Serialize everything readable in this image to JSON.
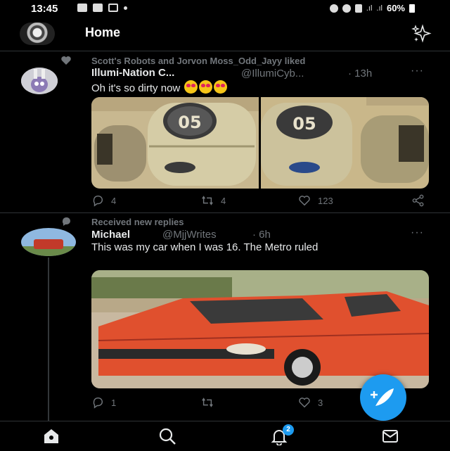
{
  "status_bar": {
    "time": "13:45",
    "battery": "60%"
  },
  "header": {
    "title": "Home"
  },
  "tweets": [
    {
      "social_context": "Scott's Robots and Jorvon Moss_Odd_Jayy liked",
      "name": "Illumi-Nation C...",
      "handle": "@IllumiCyb...",
      "time": "· 13h",
      "text": "Oh it's so dirty now",
      "emoji_count": 3,
      "image_label_left": "05",
      "image_label_right": "05",
      "replies": "4",
      "retweets": "4",
      "likes": "123"
    },
    {
      "social_context": "Received new replies",
      "name": "Michael",
      "handle": "@MjjWrites",
      "time": "· 6h",
      "text": "This was my car when I was 16. The Metro ruled",
      "replies": "1",
      "retweets": "",
      "likes": "3"
    }
  ],
  "bottom_nav": {
    "items": [
      "home-icon",
      "search-icon",
      "notifications-icon",
      "messages-icon"
    ],
    "notifications_badge": "2"
  },
  "colors": {
    "accent": "#1d9bf0",
    "background": "#000000",
    "muted": "#71767b",
    "car": "#e0502e"
  }
}
